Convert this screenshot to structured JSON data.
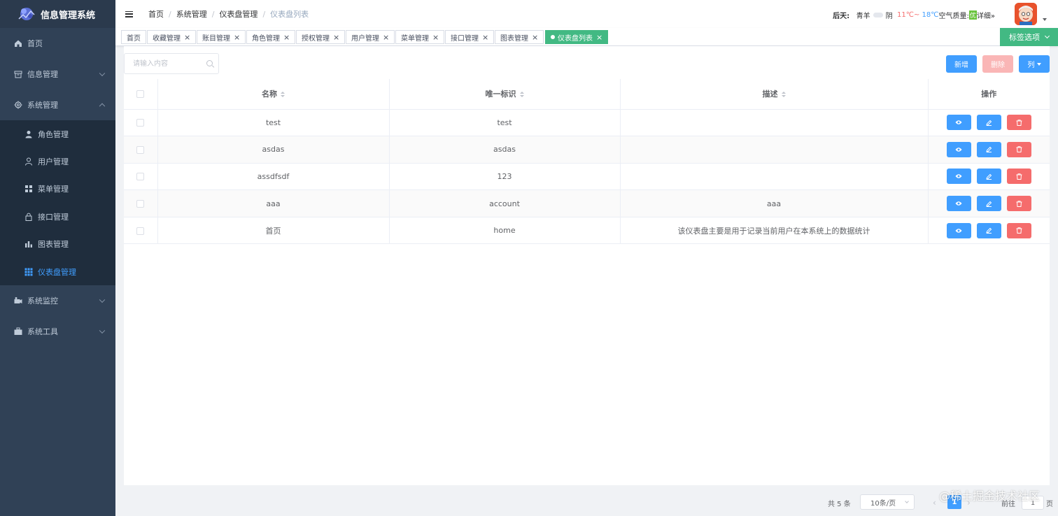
{
  "app": {
    "title": "信息管理系统"
  },
  "sidebar": {
    "items": [
      {
        "label": "首页",
        "icon": "home-icon"
      },
      {
        "label": "信息管理",
        "icon": "box-icon"
      },
      {
        "label": "系统管理",
        "icon": "gear-icon"
      },
      {
        "label": "系统监控",
        "icon": "monitor-icon"
      },
      {
        "label": "系统工具",
        "icon": "toolbox-icon"
      }
    ],
    "sub_items": [
      {
        "label": "角色管理",
        "icon": "user-filled-icon"
      },
      {
        "label": "用户管理",
        "icon": "user-icon"
      },
      {
        "label": "菜单管理",
        "icon": "grid-icon"
      },
      {
        "label": "接口管理",
        "icon": "lock-icon"
      },
      {
        "label": "图表管理",
        "icon": "bar-chart-icon"
      },
      {
        "label": "仪表盘管理",
        "icon": "dashboard-grid-icon"
      }
    ],
    "active_color": "#409eff",
    "bg_color": "#304156"
  },
  "header": {
    "breadcrumb": [
      "首页",
      "系统管理",
      "仪表盘管理",
      "仪表盘列表"
    ],
    "breadcrumb_sep": "/",
    "weather": {
      "day": "后天:",
      "city": "青羊",
      "condition": "阴",
      "high": "11℃~",
      "low": "18℃",
      "aqi_label": "空气质量:",
      "aqi_value": "优",
      "detail": "详细»"
    }
  },
  "tags": {
    "items": [
      "首页",
      "收藏管理",
      "账目管理",
      "角色管理",
      "授权管理",
      "用户管理",
      "菜单管理",
      "接口管理",
      "图表管理",
      "仪表盘列表"
    ],
    "close_glyph": "×",
    "options_label": "标签选项",
    "active_color": "#42b983"
  },
  "toolbar": {
    "search_placeholder": "请输入内容",
    "add_label": "新增",
    "delete_label": "删除",
    "columns_label": "列"
  },
  "table": {
    "headers": [
      "名称",
      "唯一标识",
      "描述",
      "操作"
    ],
    "rows": [
      {
        "name": "test",
        "key": "test",
        "desc": ""
      },
      {
        "name": "asdas",
        "key": "asdas",
        "desc": ""
      },
      {
        "name": "assdfsdf",
        "key": "123",
        "desc": ""
      },
      {
        "name": "aaa",
        "key": "account",
        "desc": "aaa"
      },
      {
        "name": "首页",
        "key": "home",
        "desc": "该仪表盘主要是用于记录当前用户在本系统上的数据统计"
      }
    ]
  },
  "pagination": {
    "total": "共 5 条",
    "page_size": "10条/页",
    "current": "1",
    "goto_label": "前往",
    "goto_value": "1",
    "goto_unit": "页"
  },
  "watermark": "@稀土掘金技术社区"
}
